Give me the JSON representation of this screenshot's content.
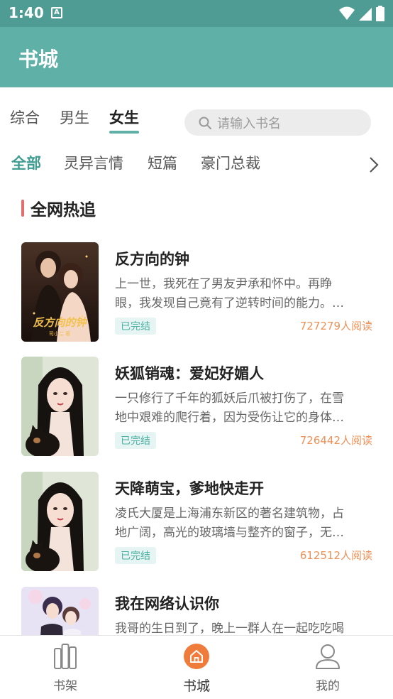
{
  "status_bar": {
    "time": "1:40",
    "notif_letter": "A"
  },
  "app_bar": {
    "title": "书城"
  },
  "tabs": [
    {
      "label": "综合",
      "active": false
    },
    {
      "label": "男生",
      "active": false
    },
    {
      "label": "女生",
      "active": true
    }
  ],
  "search": {
    "placeholder": "请输入书名"
  },
  "categories": [
    {
      "label": "全部",
      "active": true
    },
    {
      "label": "灵异言情",
      "active": false
    },
    {
      "label": "短篇",
      "active": false
    },
    {
      "label": "豪门总裁",
      "active": false
    }
  ],
  "section": {
    "title": "全网热追"
  },
  "books": [
    {
      "title": "反方向的钟",
      "desc1": "上一世，我死在了男友尹承和怀中。再睁",
      "desc2": "眼，我发现自己竟有了逆转时间的能力。…",
      "status": "已完结",
      "reads": "727279人阅读",
      "cover_title": "反方向的钟"
    },
    {
      "title": "妖狐销魂：爱妃好媚人",
      "desc1": "一只修行了千年的狐妖后爪被打伤了，在雪",
      "desc2": "地中艰难的爬行着，因为受伤让它的身体…",
      "status": "已完结",
      "reads": "726442人阅读"
    },
    {
      "title": "天降萌宝，爹地快走开",
      "desc1": "凌氏大厦是上海浦东新区的著名建筑物，占",
      "desc2": "地广阔，高光的玻璃墙与整齐的窗子，无…",
      "status": "已完结",
      "reads": "612512人阅读"
    },
    {
      "title": "我在网络认识你",
      "desc1": "我哥的生日到了，晚上一群人在一起吃吃喝",
      "desc2": "",
      "status": "",
      "reads": ""
    }
  ],
  "bottom_nav": [
    {
      "label": "书架",
      "icon": "bookshelf-icon",
      "active": false
    },
    {
      "label": "书城",
      "icon": "home-icon",
      "active": true
    },
    {
      "label": "我的",
      "icon": "user-icon",
      "active": false
    }
  ],
  "colors": {
    "primary": "#5fb0a7",
    "status_bar": "#4f9c94",
    "accent_orange": "#ee9158",
    "section_marker": "#e26d6d"
  }
}
